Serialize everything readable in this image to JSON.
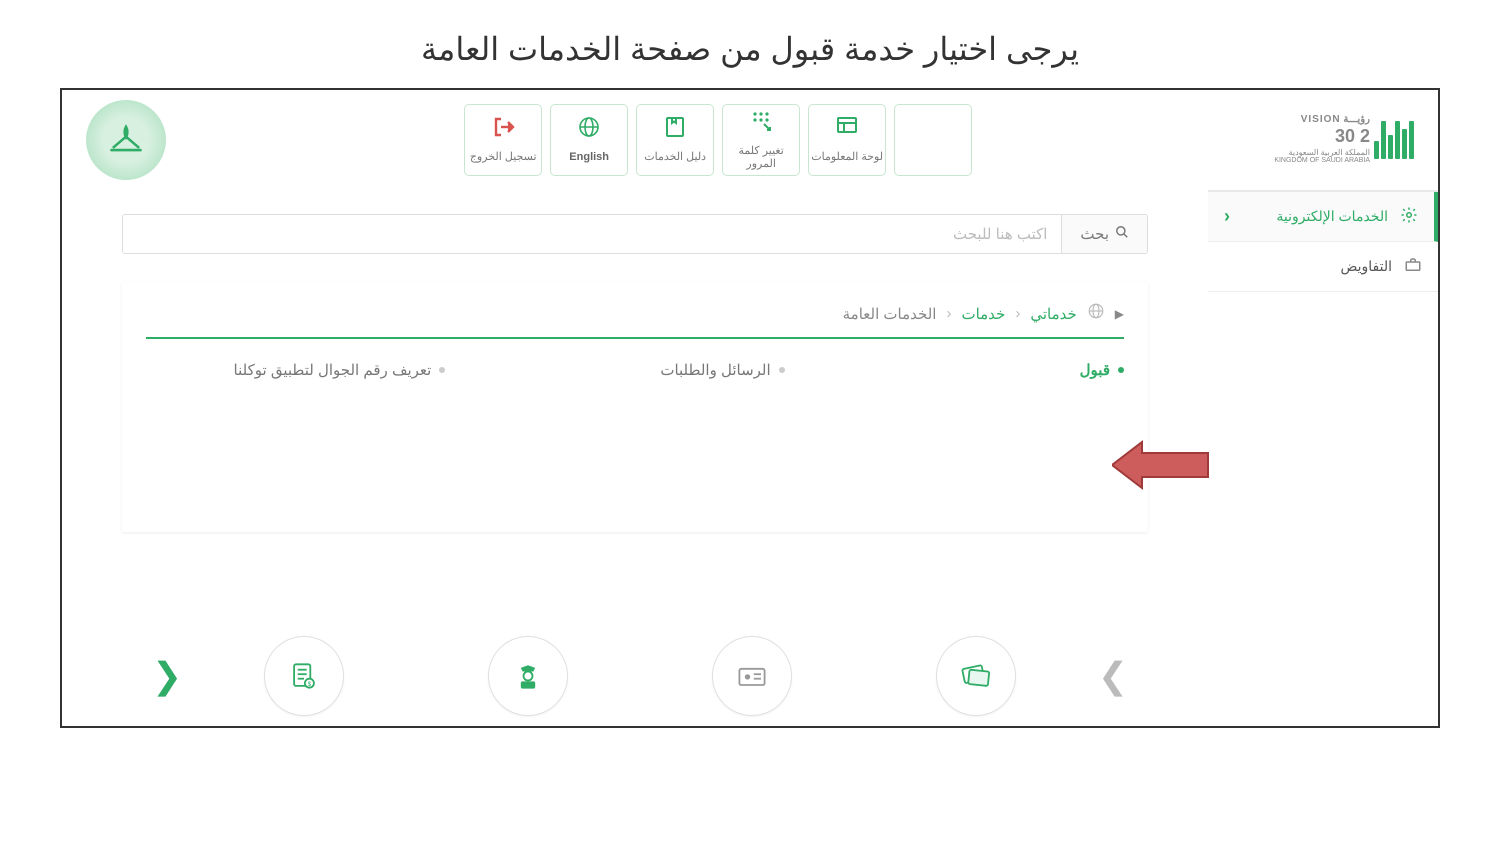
{
  "title": "يرجى اختيار خدمة قبول من صفحة الخدمات العامة",
  "vision": {
    "line1": "رؤيـــة VISION",
    "line2": "2 30",
    "line3": "المملكة العربية السعودية",
    "line4": "KINGDOM OF SAUDI ARABIA"
  },
  "toolbar": {
    "dashboard": "لوحة المعلومات",
    "password": "تغيير كلمة المرور",
    "guide": "دليل الخدمات",
    "english": "English",
    "logout": "تسجيل الخروج"
  },
  "sidebar": {
    "eservices": "الخدمات الإلكترونية",
    "delegations": "التفاويض"
  },
  "search": {
    "label": "بحث",
    "placeholder": "اكتب هنا للبحث"
  },
  "breadcrumb": {
    "root": "خدماتي",
    "level2": "خدمات",
    "current": "الخدمات العامة"
  },
  "services": {
    "qabool": "قبول",
    "messages": "الرسائل والطلبات",
    "tawakkalna": "تعريف رقم الجوال لتطبيق توكلنا"
  }
}
